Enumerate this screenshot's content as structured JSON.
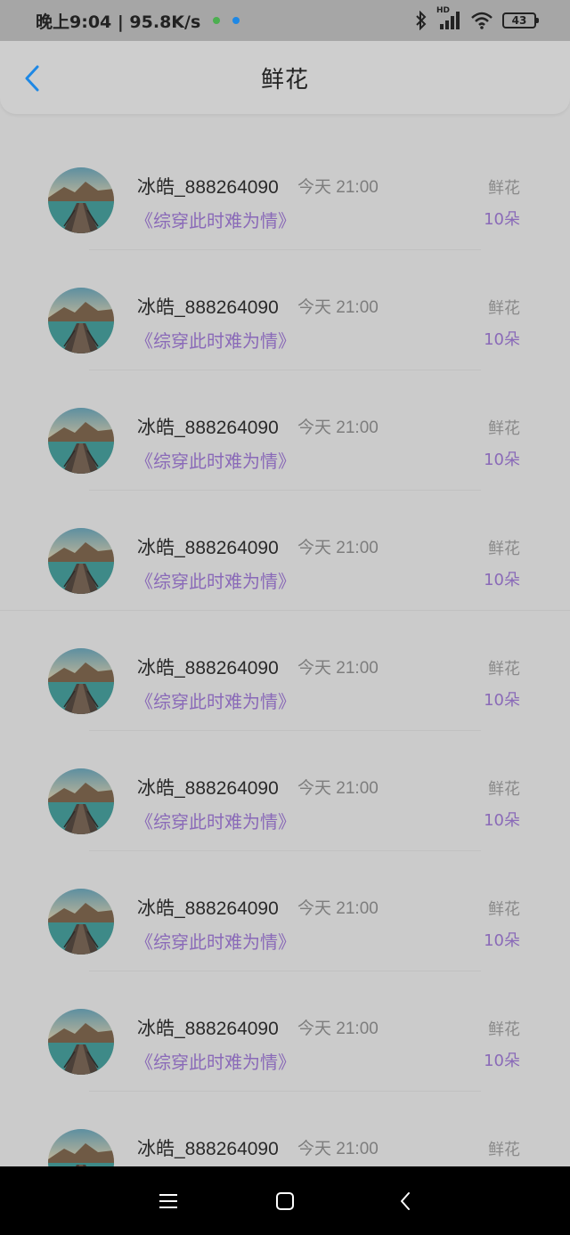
{
  "status_bar": {
    "time_speed": "晚上9:04 | 95.8K/s",
    "battery": "43",
    "net_label": "HD",
    "dot_colors": [
      "#4caf50",
      "#1e88e5"
    ]
  },
  "header": {
    "title": "鲜花",
    "back_icon": "chevron-left-icon",
    "accent": "#1e88e5"
  },
  "colors": {
    "purple": "#8a6ab8",
    "gray_text": "#7d7d7d"
  },
  "list": {
    "items": [
      {
        "name": "冰皓_888264090",
        "time": "今天 21:00",
        "book": "《综穿此时难为情》",
        "gift": "鲜花",
        "count": "10朵"
      },
      {
        "name": "冰皓_888264090",
        "time": "今天 21:00",
        "book": "《综穿此时难为情》",
        "gift": "鲜花",
        "count": "10朵"
      },
      {
        "name": "冰皓_888264090",
        "time": "今天 21:00",
        "book": "《综穿此时难为情》",
        "gift": "鲜花",
        "count": "10朵"
      },
      {
        "name": "冰皓_888264090",
        "time": "今天 21:00",
        "book": "《综穿此时难为情》",
        "gift": "鲜花",
        "count": "10朵"
      },
      {
        "name": "冰皓_888264090",
        "time": "今天 21:00",
        "book": "《综穿此时难为情》",
        "gift": "鲜花",
        "count": "10朵"
      },
      {
        "name": "冰皓_888264090",
        "time": "今天 21:00",
        "book": "《综穿此时难为情》",
        "gift": "鲜花",
        "count": "10朵"
      },
      {
        "name": "冰皓_888264090",
        "time": "今天 21:00",
        "book": "《综穿此时难为情》",
        "gift": "鲜花",
        "count": "10朵"
      },
      {
        "name": "冰皓_888264090",
        "time": "今天 21:00",
        "book": "《综穿此时难为情》",
        "gift": "鲜花",
        "count": "10朵"
      },
      {
        "name": "冰皓_888264090",
        "time": "今天 21:00",
        "book": "",
        "gift": "鲜花",
        "count": ""
      }
    ]
  },
  "nav_bar": {
    "icons": [
      "menu-icon",
      "home-square-icon",
      "back-arrow-icon"
    ]
  }
}
